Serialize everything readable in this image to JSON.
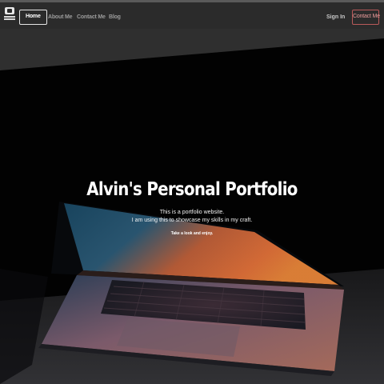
{
  "nav": {
    "links": [
      {
        "label": "Home",
        "active": true
      },
      {
        "label": "About Me",
        "active": false
      },
      {
        "label": "Contact Me",
        "active": false
      },
      {
        "label": "Blog",
        "active": false
      }
    ],
    "sign_in_label": "Sign In",
    "contact_button_label": "Contact Me"
  },
  "hero": {
    "title": "Alvin's Personal Portfolio",
    "line1": "This is a portfolio website.",
    "line2": "I am using this to showcase my skills in my craft.",
    "line3": "Take a look and enjoy."
  },
  "colors": {
    "nav_bg": "#2b2b2b",
    "contact_accent": "#b85a5a",
    "hero_overlay": "#000000"
  }
}
